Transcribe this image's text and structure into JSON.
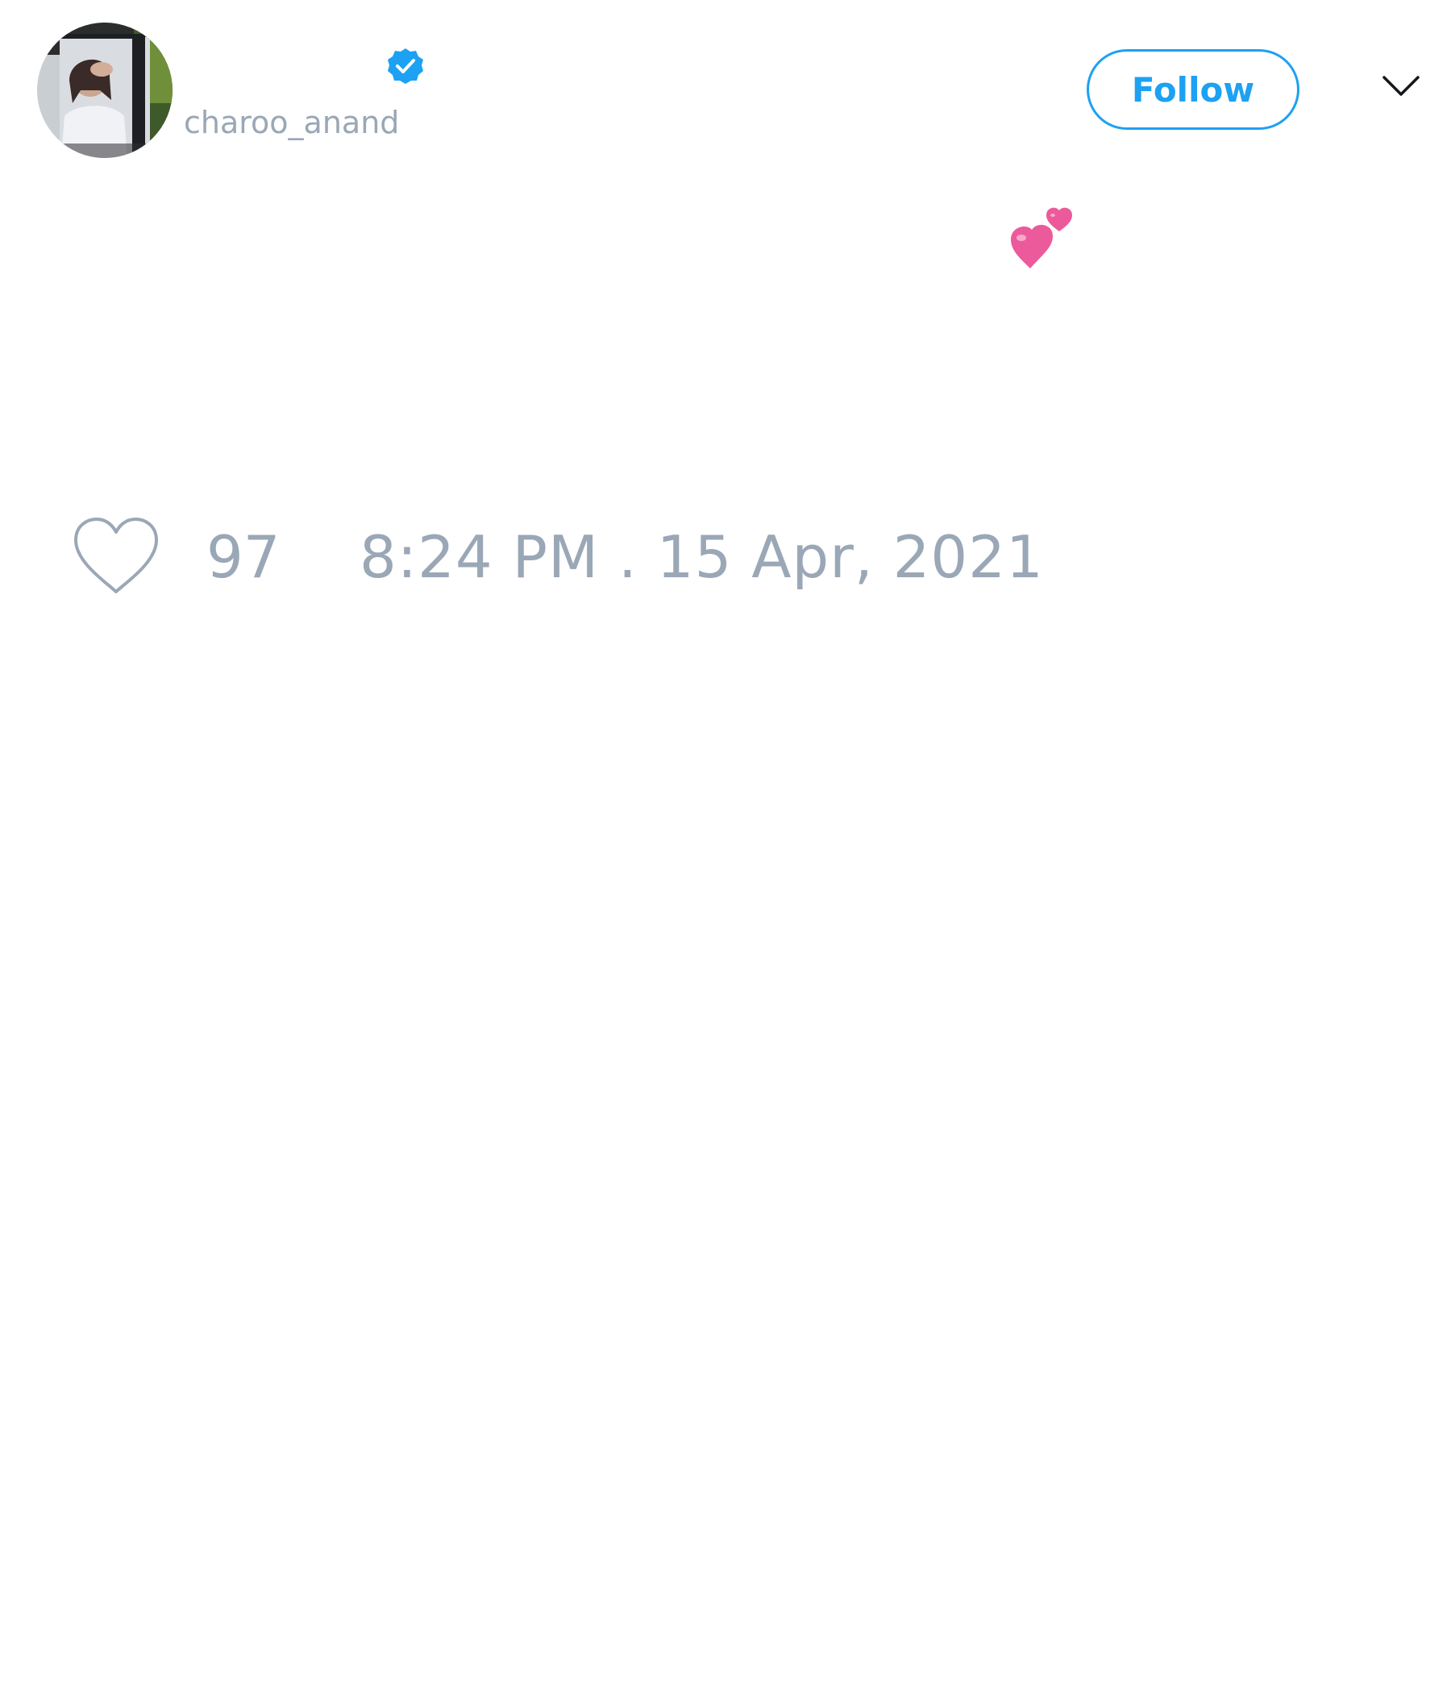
{
  "tweet": {
    "author": {
      "handle": "charoo_anand",
      "verified": true,
      "avatar": "profile-photo"
    },
    "follow_label": "Follow",
    "menu_icon": "chevron-down-icon",
    "emoji": "two-hearts-emoji",
    "likes": "97",
    "timestamp": "8:24 PM . 15 Apr, 2021"
  },
  "colors": {
    "accent": "#1da1f2",
    "muted_text": "#9aa7b6",
    "emoji_pink": "#ec5a9b"
  }
}
